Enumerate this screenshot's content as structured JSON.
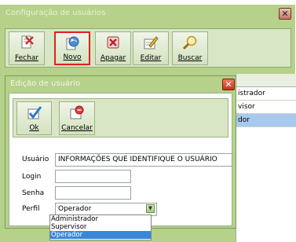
{
  "main_window": {
    "title": "Configuração de usuários",
    "close_glyph": "✕"
  },
  "toolbar": {
    "buttons": [
      {
        "label": "Fechar",
        "icon": "close-doc-icon"
      },
      {
        "label": "Novo",
        "icon": "new-globe-icon"
      },
      {
        "label": "Apagar",
        "icon": "delete-x-icon"
      },
      {
        "label": "Editar",
        "icon": "edit-pencil-icon"
      },
      {
        "label": "Buscar",
        "icon": "search-magnifier-icon"
      }
    ]
  },
  "grid": {
    "rows": [
      "istrador",
      "visor",
      "dor"
    ]
  },
  "dialog": {
    "title": "Edição de usuário",
    "close_glyph": "✕",
    "buttons": [
      {
        "label": "Ok",
        "icon": "ok-check-icon"
      },
      {
        "label": "Cancelar",
        "icon": "cancel-icon"
      }
    ],
    "fields": {
      "usuario_label": "Usuário",
      "usuario_value": "INFORMAÇÕES QUE IDENTIFIQUE O USUÁRIO",
      "login_label": "Login",
      "login_value": "",
      "senha_label": "Senha",
      "senha_value": "",
      "perfil_label": "Perfil",
      "perfil_value": "Operador"
    },
    "perfil_options": [
      "Administrador",
      "Supervisor",
      "Operador"
    ]
  },
  "colors": {
    "window_bg": "#b6d18a",
    "selection_highlight": "#e02020",
    "dropdown_selected": "#3a86d8"
  }
}
